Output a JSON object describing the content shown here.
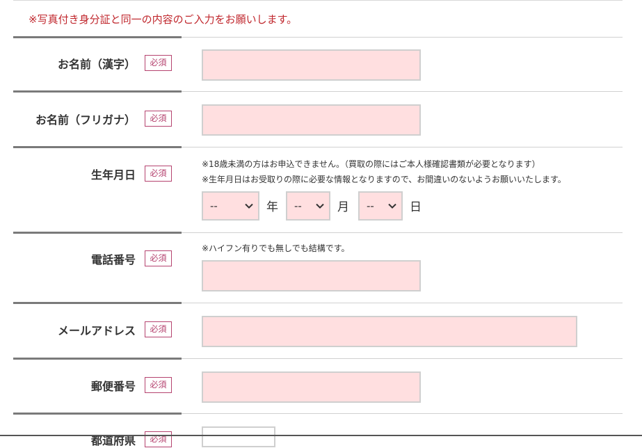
{
  "notice": "※写真付き身分証と同一の内容のご入力をお願いします。",
  "required_badge": "必須",
  "fields": {
    "name_kanji": {
      "label": "お名前（漢字）",
      "value": ""
    },
    "name_kana": {
      "label": "お名前（フリガナ）",
      "value": ""
    },
    "birthdate": {
      "label": "生年月日",
      "notes": [
        "※18歳未満の方はお申込できません。（買取の際にはご本人様確認書類が必要となります）",
        "※生年月日はお受取りの際に必要な情報となりますので、お間違いのないようお願いいたします。"
      ],
      "year": {
        "selected": "--",
        "unit": "年"
      },
      "month": {
        "selected": "--",
        "unit": "月"
      },
      "day": {
        "selected": "--",
        "unit": "日"
      }
    },
    "phone": {
      "label": "電話番号",
      "note": "※ハイフン有りでも無しでも結構です。",
      "value": ""
    },
    "email": {
      "label": "メールアドレス",
      "value": ""
    },
    "postal": {
      "label": "郵便番号",
      "value": ""
    },
    "prefecture": {
      "label": "都道府県"
    }
  },
  "colors": {
    "input_bg": "#ffdfe0",
    "badge": "#b5436f",
    "notice": "#c0272d"
  }
}
